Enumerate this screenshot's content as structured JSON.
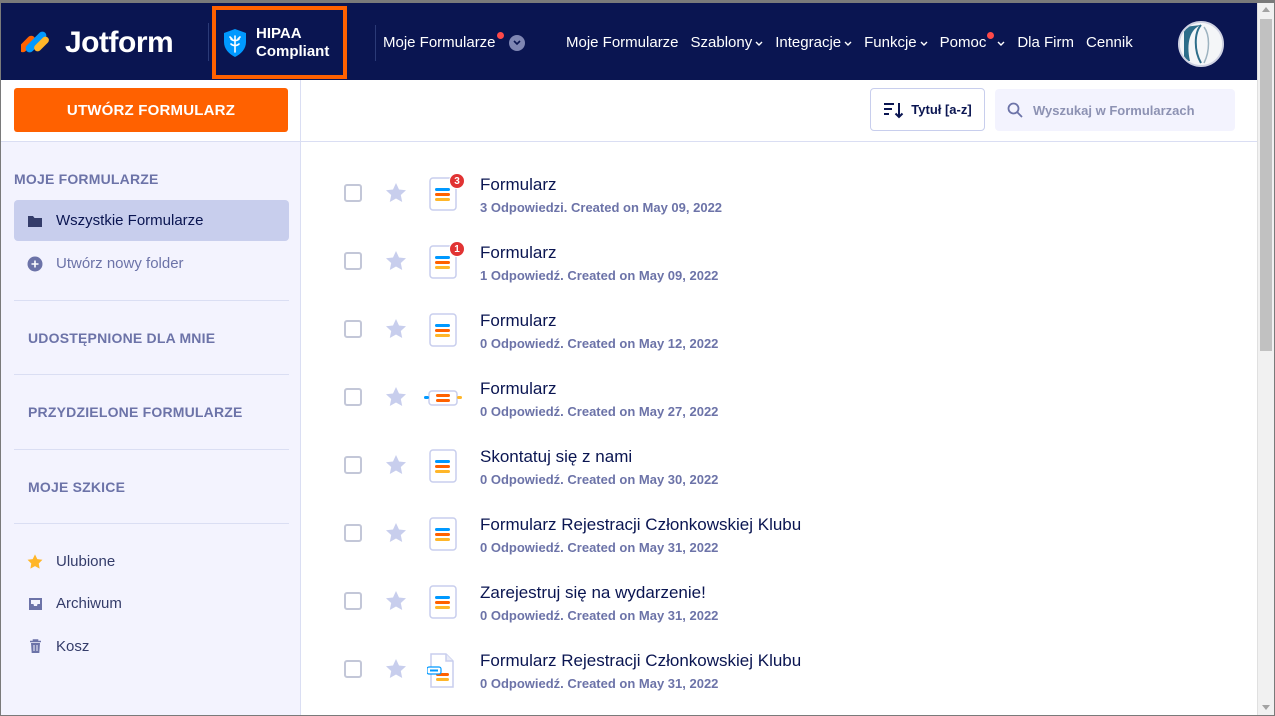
{
  "header": {
    "logo_text": "Jotform",
    "hipaa_line1": "HIPAA",
    "hipaa_line2": "Compliant",
    "my_forms_dropdown": "Moje Formularze",
    "nav": [
      {
        "label": "Moje Formularze",
        "caret": false,
        "dot": false
      },
      {
        "label": "Szablony",
        "caret": true,
        "dot": false
      },
      {
        "label": "Integracje",
        "caret": true,
        "dot": false
      },
      {
        "label": "Funkcje",
        "caret": true,
        "dot": false
      },
      {
        "label": "Pomoc",
        "caret": true,
        "dot": true
      },
      {
        "label": "Dla Firm",
        "caret": false,
        "dot": false
      },
      {
        "label": "Cennik",
        "caret": false,
        "dot": false
      }
    ]
  },
  "sidebar": {
    "create_button": "UTWÓRZ FORMULARZ",
    "section_title": "MOJE FORMULARZE",
    "all_forms": "Wszystkie Formularze",
    "new_folder": "Utwórz nowy folder",
    "shared": "UDOSTĘPNIONE DLA MNIE",
    "assigned": "PRZYDZIELONE FORMULARZE",
    "drafts": "MOJE SZKICE",
    "favorites": "Ulubione",
    "archive": "Archiwum",
    "trash": "Kosz"
  },
  "toolbar": {
    "sort_label": "Tytuł [a-z]",
    "search_placeholder": "Wyszukaj w Formularzach"
  },
  "forms": [
    {
      "title": "Formularz",
      "meta": "3 Odpowiedzi. Created on May 09, 2022",
      "badge": "3",
      "icon": "form"
    },
    {
      "title": "Formularz",
      "meta": "1 Odpowiedź. Created on May 09, 2022",
      "badge": "1",
      "icon": "form"
    },
    {
      "title": "Formularz",
      "meta": "0 Odpowiedź. Created on May 12, 2022",
      "badge": "",
      "icon": "form"
    },
    {
      "title": "Formularz",
      "meta": "0 Odpowiedź. Created on May 27, 2022",
      "badge": "",
      "icon": "card"
    },
    {
      "title": "Skontatuj się z nami",
      "meta": "0 Odpowiedź. Created on May 30, 2022",
      "badge": "",
      "icon": "form"
    },
    {
      "title": "Formularz Rejestracji Członkowskiej Klubu",
      "meta": "0 Odpowiedź. Created on May 31, 2022",
      "badge": "",
      "icon": "form"
    },
    {
      "title": "Zarejestruj się na wydarzenie!",
      "meta": "0 Odpowiedź. Created on May 31, 2022",
      "badge": "",
      "icon": "form"
    },
    {
      "title": "Formularz Rejestracji Członkowskiej Klubu",
      "meta": "0 Odpowiedź. Created on May 31, 2022",
      "badge": "",
      "icon": "pdf"
    }
  ],
  "colors": {
    "header_bg": "#0a1551",
    "accent_orange": "#ff6100",
    "sidebar_bg": "#f3f3fe",
    "active_item": "#c8ceed",
    "badge_red": "#e13333"
  }
}
